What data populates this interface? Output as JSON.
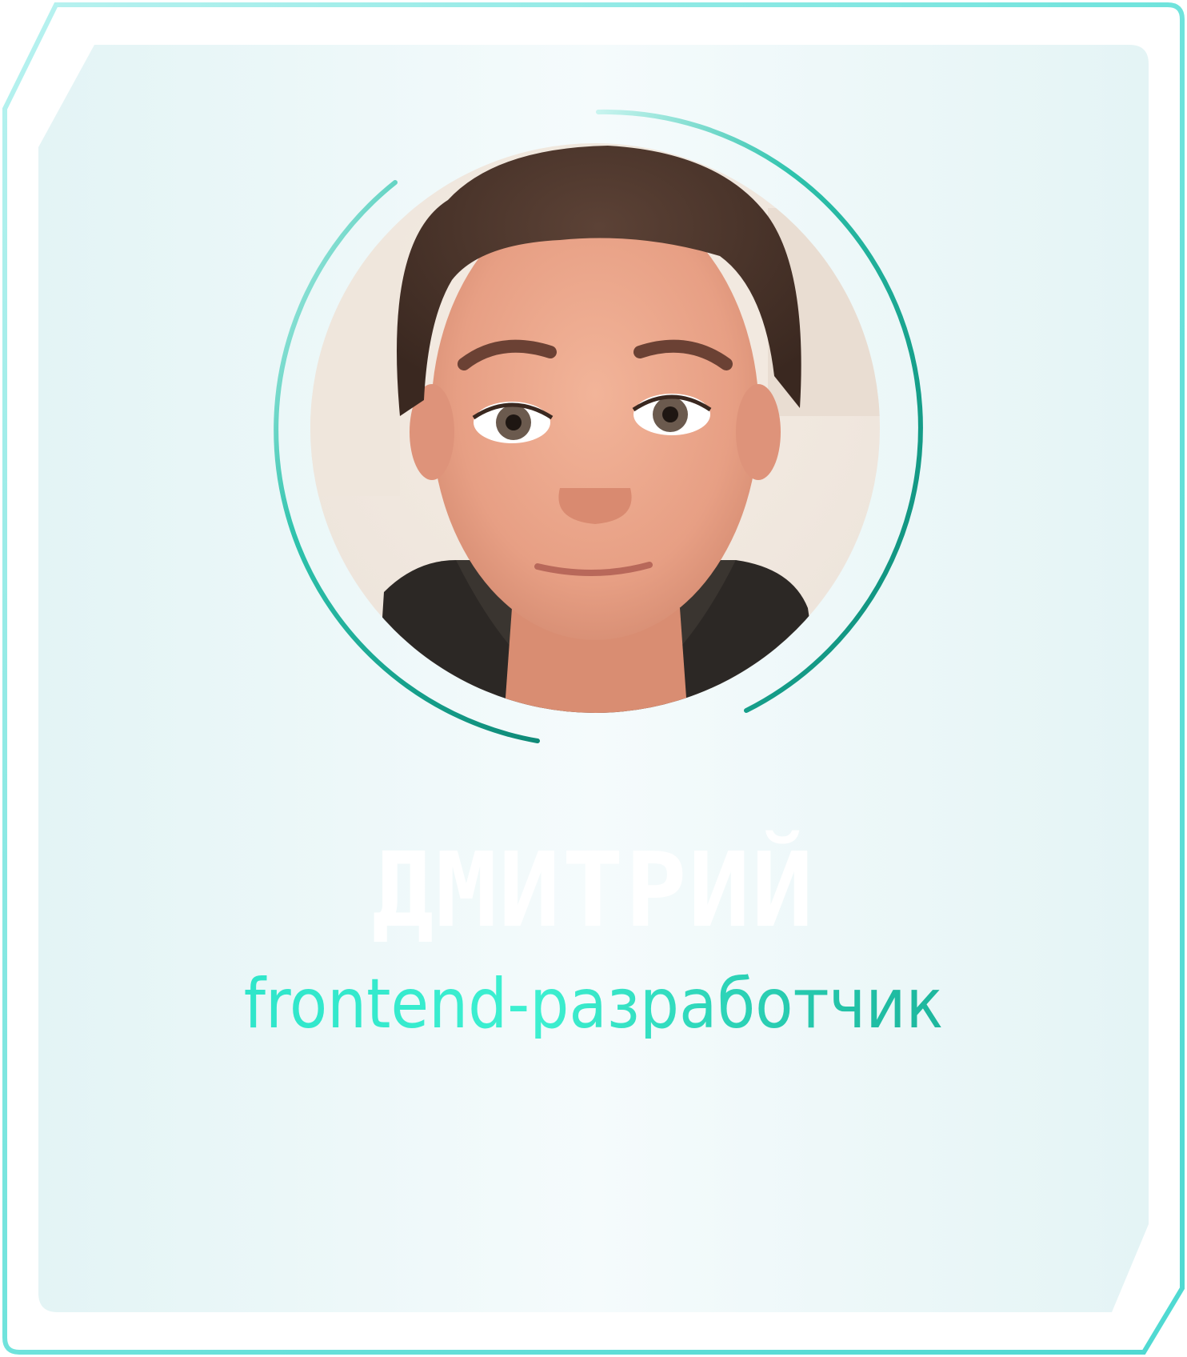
{
  "profile": {
    "name": "ДМИТРИЙ",
    "role": "frontend-разработчик"
  },
  "colors": {
    "frame_border": "#7fe9e4",
    "card_background": "#e6f5f6",
    "ring_accent": "#18a890",
    "role_text": "#2ed6bd",
    "name_text": "#ffffff"
  },
  "avatar": {
    "icon": "person-portrait-icon"
  }
}
